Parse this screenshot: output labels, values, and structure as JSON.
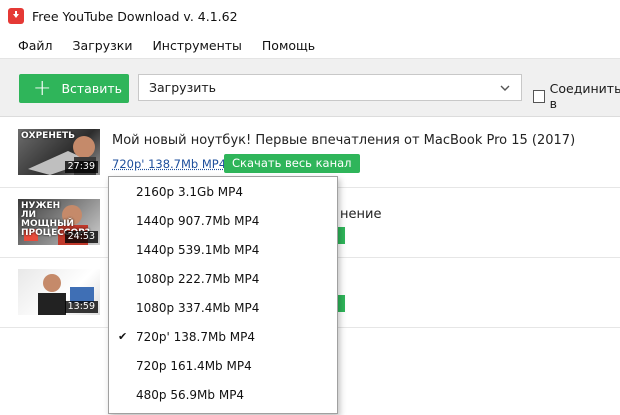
{
  "window": {
    "title": "Free YouTube Download v. 4.1.62"
  },
  "menu": [
    "Файл",
    "Загрузки",
    "Инструменты",
    "Помощь"
  ],
  "toolbar": {
    "paste_label": "Вставить",
    "download_value": "Загрузить",
    "merge_label": "Соединить в"
  },
  "videos": [
    {
      "title": "Мой новый ноутбук! Первые впечатления от MacBook Pro 15 (2017)",
      "quality": "720p' 138.7Mb MP4",
      "channel_button": "Скачать весь канал",
      "duration": "27:39",
      "thumb_caption": "ОХРЕНЕТЬ"
    },
    {
      "title_partial": "нение",
      "duration": "24:53",
      "thumb_caption": "НУЖЕН ЛИ МОЩНЫЙ ПРОЦЕССОР?"
    },
    {
      "duration": "13:59"
    }
  ],
  "quality_options": [
    {
      "label": "2160p 3.1Gb MP4",
      "selected": false
    },
    {
      "label": "1440p 907.7Mb MP4",
      "selected": false
    },
    {
      "label": "1440p 539.1Mb MP4",
      "selected": false
    },
    {
      "label": "1080p 222.7Mb MP4",
      "selected": false
    },
    {
      "label": "1080p 337.4Mb MP4",
      "selected": false
    },
    {
      "label": "720p' 138.7Mb MP4",
      "selected": true
    },
    {
      "label": "720p 161.4Mb MP4",
      "selected": false
    },
    {
      "label": "480p 56.9Mb MP4",
      "selected": false
    }
  ],
  "icons": {
    "app": "download-arrow-icon",
    "check": "checkmark-icon",
    "dropdown": "chevron-down-icon"
  },
  "colors": {
    "accent_green": "#2fb55a",
    "app_red": "#e53935",
    "link_blue": "#1e4f9c"
  }
}
